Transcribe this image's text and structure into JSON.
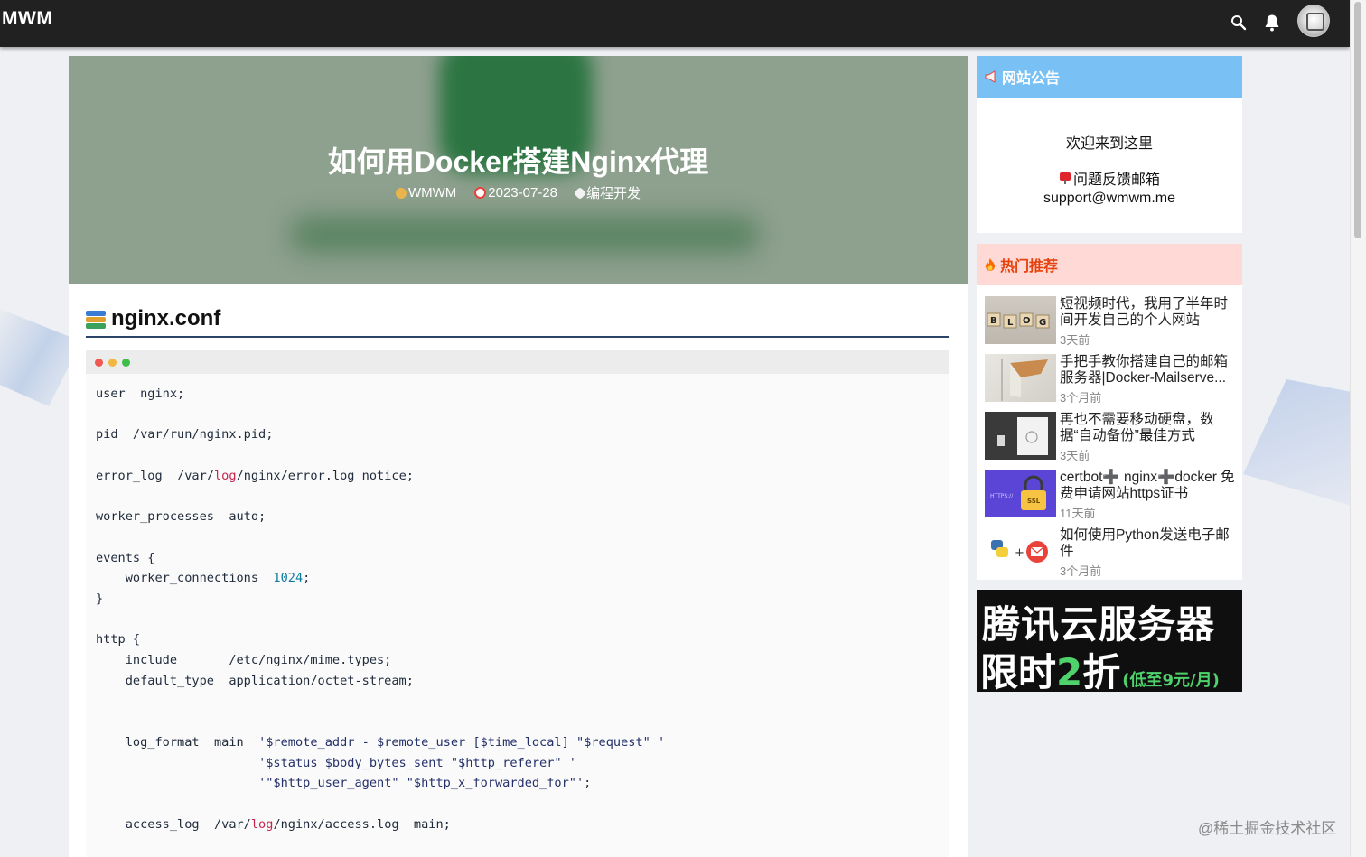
{
  "header": {
    "brand": "MWM",
    "icons": [
      "search-icon",
      "bell-icon"
    ],
    "avatar": "avatar"
  },
  "post": {
    "title": "如何用Docker搭建Nginx代理",
    "author": "WMWM",
    "date": "2023-07-28",
    "category": "编程开发",
    "section_heading": "nginx.conf",
    "code_lines": [
      "user  nginx;",
      "",
      "pid  /var/run/nginx.pid;",
      "",
      "error_log  /var/log/nginx/error.log notice;",
      "",
      "worker_processes  auto;",
      "",
      "events {",
      "    worker_connections  1024;",
      "}",
      "",
      "http {",
      "    include       /etc/nginx/mime.types;",
      "    default_type  application/octet-stream;",
      "",
      "",
      "    log_format  main  '$remote_addr - $remote_user [$time_local] \"$request\" '",
      "                      '$status $body_bytes_sent \"$http_referer\" '",
      "                      '\"$http_user_agent\" \"$http_x_forwarded_for\"';",
      "",
      "    access_log  /var/log/nginx/access.log  main;"
    ]
  },
  "sidebar": {
    "notice": {
      "title": "网站公告",
      "welcome": "欢迎来到这里",
      "feedback_label": "问题反馈邮箱",
      "email": "support@wmwm.me"
    },
    "hot": {
      "title": "热门推荐",
      "items": [
        {
          "title": "短视频时代，我用了半年时间开发自己的个人网站",
          "time": "3天前",
          "thumb": "blog-blocks-image"
        },
        {
          "title": "手把手教你搭建自己的邮箱服务器|Docker-Mailserve...",
          "time": "3个月前",
          "thumb": "envelope-image"
        },
        {
          "title": "再也不需要移动硬盘，数据“自动备份”最佳方式",
          "time": "3天前",
          "thumb": "nas-device-image"
        },
        {
          "title": "certbot➕ nginx➕docker 免费申请网站https证书",
          "time": "11天前",
          "thumb": "ssl-lock-image"
        },
        {
          "title": "如何使用Python发送电子邮件",
          "time": "3个月前",
          "thumb": "python-mail-image"
        }
      ]
    },
    "ad": {
      "line1": "腾讯云服务器",
      "line2_a": "限时",
      "line2_b": "2",
      "line2_c": "折",
      "line2_d": "(低至9元/月)"
    }
  },
  "watermark": "@稀土掘金技术社区",
  "colors": {
    "topbar": "#212121",
    "notice_header": "#79c1f5",
    "hot_header": "#ffd9d5",
    "hot_title": "#e5420e",
    "hero_bg": "#8ea08e"
  }
}
